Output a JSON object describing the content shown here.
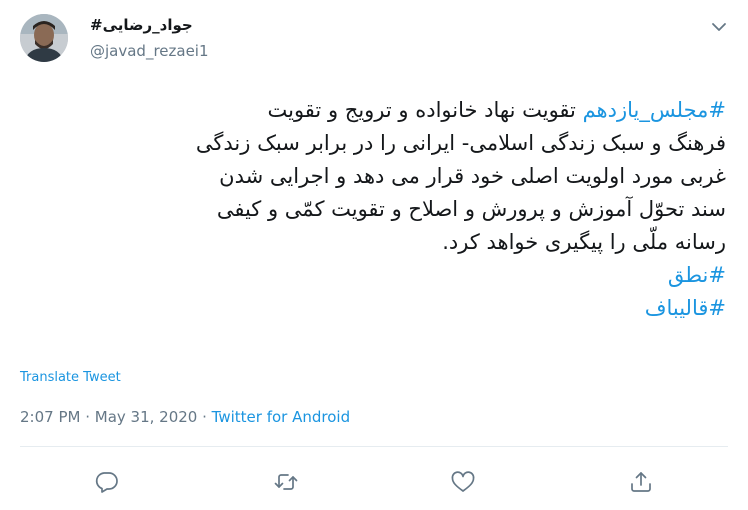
{
  "user": {
    "display_name": "#جواد_رضایی",
    "handle": "@javad_rezaei1"
  },
  "tweet": {
    "lines": [
      [
        {
          "text": "#مجلس_یازدهم",
          "tag": true
        },
        {
          "text": " تقویت نهاد خانواده و ترویج و تقویت",
          "tag": false
        }
      ],
      [
        {
          "text": "فرهنگ و سبک زندگی اسلامی- ایرانی را در برابر سبک زندگی",
          "tag": false
        }
      ],
      [
        {
          "text": "غربی مورد اولویت اصلی خود قرار می دهد و اجرایی شدن",
          "tag": false
        }
      ],
      [
        {
          "text": "سند تحوّل آموزش و پرورش و اصلاح و تقویت کمّی و کیفی",
          "tag": false
        }
      ],
      [
        {
          "text": "رسانه ملّی را پیگیری خواهد کرد.",
          "tag": false
        }
      ],
      [
        {
          "text": "#نطق",
          "tag": true
        }
      ],
      [
        {
          "text": "#قالیباف",
          "tag": true
        }
      ]
    ]
  },
  "translate_label": "Translate Tweet",
  "meta": {
    "time": "2:07 PM",
    "sep1": " · ",
    "date": "May 31, 2020",
    "sep2": " · ",
    "source": "Twitter for Android"
  },
  "icons": {
    "caret": "chevron-down-icon",
    "reply": "reply-icon",
    "retweet": "retweet-icon",
    "like": "heart-icon",
    "share": "share-icon"
  },
  "colors": {
    "link": "#1b95e0",
    "secondary_text": "#657786",
    "icon_gray": "#657786"
  }
}
